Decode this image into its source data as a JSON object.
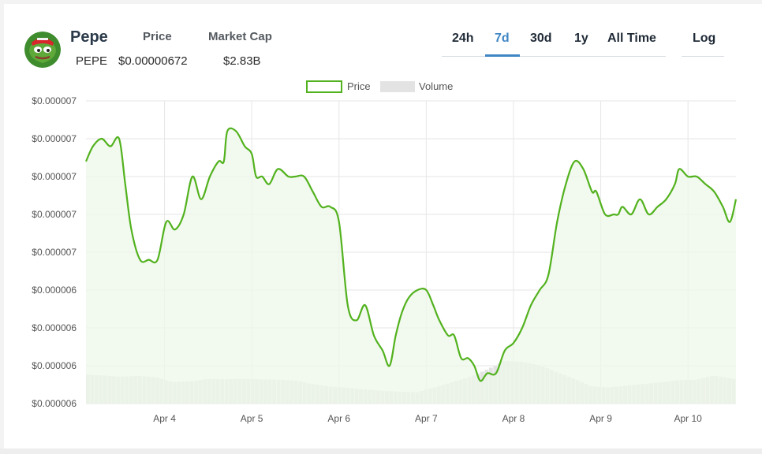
{
  "coin": {
    "name": "Pepe",
    "symbol": "PEPE",
    "price_label": "Price",
    "price_value": "$0.00000672",
    "market_cap_label": "Market Cap",
    "market_cap_value": "$2.83B"
  },
  "timeframes": {
    "tabs": [
      "24h",
      "7d",
      "30d",
      "1y",
      "All Time"
    ],
    "active": "7d"
  },
  "scale_toggle": {
    "label": "Log"
  },
  "colors": {
    "price_line": "#52b21e",
    "price_fill": "#eef7e9",
    "volume_bar": "#e3e3e3",
    "active_tab": "#3f86c4"
  },
  "chart_data": {
    "type": "line",
    "legend": [
      "Price",
      "Volume"
    ],
    "legend_placement": "top-center",
    "grid": true,
    "y_tick_labels": [
      "$0.000007",
      "$0.000007",
      "$0.000007",
      "$0.000007",
      "$0.000007",
      "$0.000006",
      "$0.000006",
      "$0.000006",
      "$0.000006"
    ],
    "y_ticks": [
      7.15e-06,
      7.1e-06,
      7.05e-06,
      7e-06,
      6.95e-06,
      6.9e-06,
      6.85e-06,
      6.8e-06,
      6.75e-06
    ],
    "ylim": [
      6.75e-06,
      7.15e-06
    ],
    "x_tick_labels": [
      "Apr 4",
      "Apr 5",
      "Apr 6",
      "Apr 7",
      "Apr 8",
      "Apr 9",
      "Apr 10"
    ],
    "x_ticks": [
      1,
      2,
      3,
      4,
      5,
      6,
      7
    ],
    "xlim": [
      0.1,
      7.55
    ],
    "series": [
      {
        "name": "Price",
        "x": [
          0.1,
          0.18,
          0.28,
          0.38,
          0.48,
          0.55,
          0.62,
          0.72,
          0.82,
          0.92,
          1.02,
          1.12,
          1.22,
          1.32,
          1.42,
          1.52,
          1.62,
          1.68,
          1.72,
          1.82,
          1.92,
          2.0,
          2.05,
          2.12,
          2.2,
          2.3,
          2.42,
          2.5,
          2.6,
          2.7,
          2.8,
          2.9,
          3.0,
          3.1,
          3.2,
          3.3,
          3.4,
          3.5,
          3.58,
          3.65,
          3.72,
          3.8,
          3.9,
          4.0,
          4.08,
          4.15,
          4.25,
          4.32,
          4.4,
          4.48,
          4.55,
          4.62,
          4.7,
          4.8,
          4.9,
          5.0,
          5.1,
          5.2,
          5.3,
          5.4,
          5.5,
          5.6,
          5.7,
          5.8,
          5.9,
          5.95,
          6.05,
          6.15,
          6.2,
          6.25,
          6.35,
          6.45,
          6.55,
          6.65,
          6.75,
          6.85,
          6.9,
          7.0,
          7.1,
          7.2,
          7.3,
          7.4,
          7.48,
          7.55
        ],
        "y": [
          7.07e-06,
          7.09e-06,
          7.1e-06,
          7.09e-06,
          7.1e-06,
          7.04e-06,
          6.98e-06,
          6.94e-06,
          6.94e-06,
          6.94e-06,
          6.99e-06,
          6.98e-06,
          7e-06,
          7.05e-06,
          7.02e-06,
          7.05e-06,
          7.07e-06,
          7.07e-06,
          7.11e-06,
          7.11e-06,
          7.09e-06,
          7.08e-06,
          7.05e-06,
          7.05e-06,
          7.04e-06,
          7.06e-06,
          7.05e-06,
          7.05e-06,
          7.05e-06,
          7.03e-06,
          7.01e-06,
          7.01e-06,
          6.99e-06,
          6.88e-06,
          6.86e-06,
          6.88e-06,
          6.84e-06,
          6.82e-06,
          6.8e-06,
          6.84e-06,
          6.87e-06,
          6.89e-06,
          6.9e-06,
          6.9e-06,
          6.88e-06,
          6.86e-06,
          6.84e-06,
          6.84e-06,
          6.81e-06,
          6.81e-06,
          6.8e-06,
          6.78e-06,
          6.79e-06,
          6.79e-06,
          6.82e-06,
          6.83e-06,
          6.85e-06,
          6.88e-06,
          6.9e-06,
          6.92e-06,
          6.99e-06,
          7.04e-06,
          7.07e-06,
          7.06e-06,
          7.03e-06,
          7.03e-06,
          7e-06,
          7e-06,
          7e-06,
          7.01e-06,
          7e-06,
          7.02e-06,
          7e-06,
          7.01e-06,
          7.02e-06,
          7.04e-06,
          7.06e-06,
          7.05e-06,
          7.05e-06,
          7.04e-06,
          7.03e-06,
          7.01e-06,
          6.99e-06,
          7.02e-06
        ]
      },
      {
        "name": "Volume",
        "x": [
          0.1,
          0.3,
          0.5,
          0.7,
          0.9,
          1.1,
          1.3,
          1.5,
          1.7,
          1.9,
          2.1,
          2.3,
          2.5,
          2.7,
          2.9,
          3.1,
          3.3,
          3.5,
          3.7,
          3.9,
          4.1,
          4.3,
          4.5,
          4.7,
          4.9,
          5.1,
          5.3,
          5.5,
          5.7,
          5.9,
          6.1,
          6.3,
          6.5,
          6.7,
          6.9,
          7.1,
          7.3,
          7.55
        ],
        "y": [
          0.68,
          0.66,
          0.63,
          0.65,
          0.62,
          0.5,
          0.52,
          0.58,
          0.57,
          0.58,
          0.57,
          0.56,
          0.54,
          0.46,
          0.4,
          0.37,
          0.33,
          0.3,
          0.28,
          0.27,
          0.38,
          0.5,
          0.62,
          0.8,
          1.0,
          0.98,
          0.9,
          0.74,
          0.58,
          0.4,
          0.38,
          0.42,
          0.46,
          0.5,
          0.55,
          0.56,
          0.66,
          0.57
        ]
      }
    ]
  }
}
